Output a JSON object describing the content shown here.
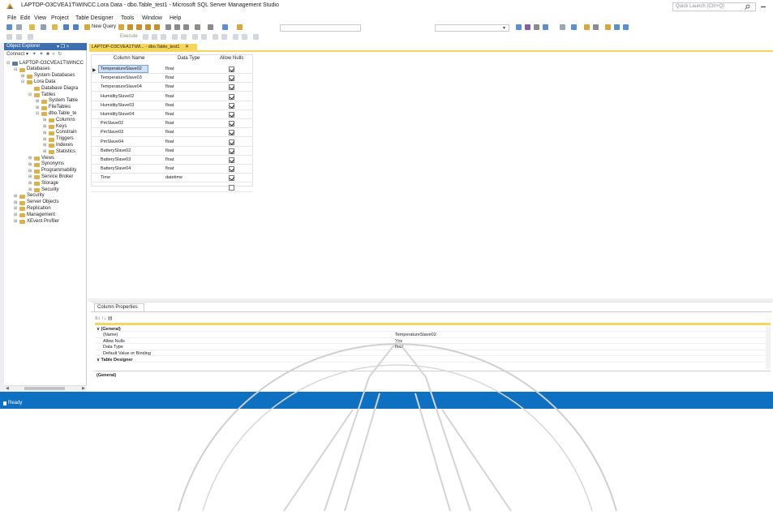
{
  "window": {
    "title": "LAPTOP-O3CVEA1T\\WINCC.Lora Data - dbo.Table_test1 - Microsoft SQL Server Management Studio",
    "quick_launch_placeholder": "Quick Launch (Ctrl+Q)"
  },
  "menu": [
    "File",
    "Edit",
    "View",
    "Project",
    "Table Designer",
    "Tools",
    "Window",
    "Help"
  ],
  "toolbar": {
    "new_query": "New Query",
    "execute": "Execute"
  },
  "object_explorer": {
    "title": "Object Explorer",
    "header_controls": "▾ ❐ ×",
    "connect": "Connect ▾",
    "tree": [
      {
        "label": "LAPTOP-O3CVEA1T\\WINCC",
        "level": 0,
        "exp": "⊟"
      },
      {
        "label": "Databases",
        "level": 1,
        "exp": "⊟"
      },
      {
        "label": "System Databases",
        "level": 2,
        "exp": "⊞"
      },
      {
        "label": "Lora Data",
        "level": 2,
        "exp": "⊟"
      },
      {
        "label": "Database Diagra",
        "level": 3,
        "exp": ""
      },
      {
        "label": "Tables",
        "level": 3,
        "exp": "⊟"
      },
      {
        "label": "System Table",
        "level": 4,
        "exp": "⊞"
      },
      {
        "label": "FileTables",
        "level": 4,
        "exp": "⊞"
      },
      {
        "label": "dbo.Table_te",
        "level": 4,
        "exp": "⊟"
      },
      {
        "label": "Columns",
        "level": 5,
        "exp": "⊞"
      },
      {
        "label": "Keys",
        "level": 5,
        "exp": "⊞"
      },
      {
        "label": "Constrain",
        "level": 5,
        "exp": "⊞"
      },
      {
        "label": "Triggers",
        "level": 5,
        "exp": "⊞"
      },
      {
        "label": "Indexes",
        "level": 5,
        "exp": "⊞"
      },
      {
        "label": "Statistics",
        "level": 5,
        "exp": "⊞"
      },
      {
        "label": "Views",
        "level": 3,
        "exp": "⊞"
      },
      {
        "label": "Synonyms",
        "level": 3,
        "exp": "⊞"
      },
      {
        "label": "Programmability",
        "level": 3,
        "exp": "⊞"
      },
      {
        "label": "Service Broker",
        "level": 3,
        "exp": "⊞"
      },
      {
        "label": "Storage",
        "level": 3,
        "exp": "⊞"
      },
      {
        "label": "Security",
        "level": 3,
        "exp": "⊞"
      },
      {
        "label": "Security",
        "level": 1,
        "exp": "⊞"
      },
      {
        "label": "Server Objects",
        "level": 1,
        "exp": "⊞"
      },
      {
        "label": "Replication",
        "level": 1,
        "exp": "⊞"
      },
      {
        "label": "Management",
        "level": 1,
        "exp": "⊞"
      },
      {
        "label": "XEvent Profiler",
        "level": 1,
        "exp": "⊞"
      }
    ]
  },
  "document_tab": {
    "label": "LAPTOP-O3CVEA1T\\Wl... - dbo.Table_test1",
    "close": "✕",
    "pin": "⊙"
  },
  "designer_grid": {
    "headers": [
      "Column Name",
      "Data Type",
      "Allow Nulls"
    ],
    "rows": [
      {
        "name": "TemperatureSlave02",
        "type": "float",
        "nulls": true
      },
      {
        "name": "TemperatureSlave03",
        "type": "float",
        "nulls": true
      },
      {
        "name": "TemperatureSlave04",
        "type": "float",
        "nulls": true
      },
      {
        "name": "HumiditySlave02",
        "type": "float",
        "nulls": true
      },
      {
        "name": "HumiditySlave03",
        "type": "float",
        "nulls": true
      },
      {
        "name": "HumiditySlave04",
        "type": "float",
        "nulls": true
      },
      {
        "name": "PmSlave02",
        "type": "float",
        "nulls": true
      },
      {
        "name": "PmSlave03",
        "type": "float",
        "nulls": true
      },
      {
        "name": "PmSlave04",
        "type": "float",
        "nulls": true
      },
      {
        "name": "BatterySlave02",
        "type": "float",
        "nulls": true
      },
      {
        "name": "BatterySlave03",
        "type": "float",
        "nulls": true
      },
      {
        "name": "BatterySlave04",
        "type": "float",
        "nulls": true
      },
      {
        "name": "Time",
        "type": "datetime",
        "nulls": true
      },
      {
        "name": "",
        "type": "",
        "nulls": false
      }
    ]
  },
  "column_properties": {
    "tab": "Column Properties",
    "toolbar_icons": "≡↕ ↑↓ ▤",
    "rows": [
      {
        "label": "∨  (General)",
        "value": "",
        "bold": true
      },
      {
        "label": "(Name)",
        "value": "TemperatureSlave02",
        "bold": false
      },
      {
        "label": "Allow Nulls",
        "value": "Yes",
        "bold": false
      },
      {
        "label": "Data Type",
        "value": "float",
        "bold": false
      },
      {
        "label": "Default Value or Binding",
        "value": "",
        "bold": false
      },
      {
        "label": "∨  Table Designer",
        "value": "",
        "bold": true
      }
    ],
    "description_title": "(General)"
  },
  "status": {
    "text": "Ready"
  },
  "colors": {
    "accent_blue": "#0e70c0",
    "tab_yellow": "#f6d55c",
    "oe_header": "#3d6fb1",
    "folder": "#dcb148"
  }
}
